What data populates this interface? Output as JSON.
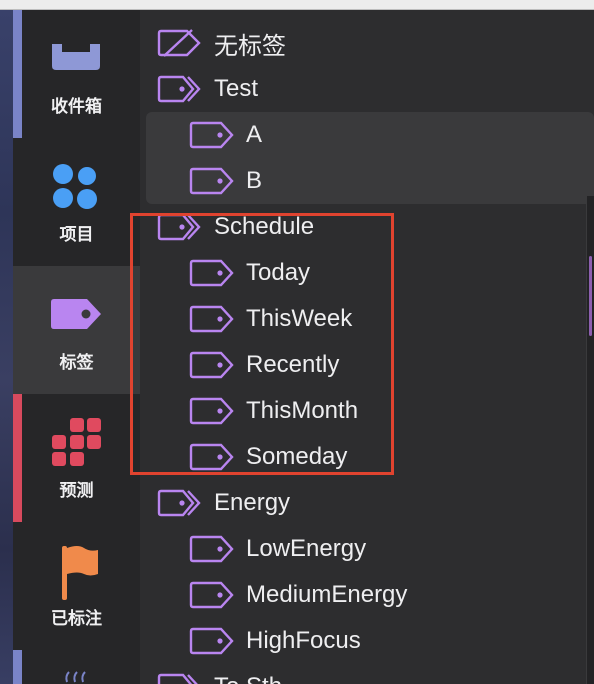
{
  "sidebar": {
    "items": [
      {
        "label": "收件箱",
        "icon": "inbox-icon",
        "accent": "#7a84c8"
      },
      {
        "label": "项目",
        "icon": "projects-icon"
      },
      {
        "label": "标签",
        "icon": "tag-icon",
        "active": true
      },
      {
        "label": "预测",
        "icon": "forecast-icon",
        "accent": "#d84a5e"
      },
      {
        "label": "已标注",
        "icon": "flag-icon"
      }
    ]
  },
  "tags": {
    "untagged": "无标签",
    "test": "Test",
    "test_children": [
      "A",
      "B"
    ],
    "schedule": "Schedule",
    "schedule_children": [
      "Today",
      "ThisWeek",
      "Recently",
      "ThisMonth",
      "Someday"
    ],
    "energy": "Energy",
    "energy_children": [
      "LowEnergy",
      "MediumEnergy",
      "HighFocus"
    ],
    "next_partial": "To Sth"
  },
  "colors": {
    "tag_icon": "#b985f0",
    "highlight": "#e0432f",
    "sidebar_bg": "#262628",
    "content_bg": "#2d2d2f"
  }
}
